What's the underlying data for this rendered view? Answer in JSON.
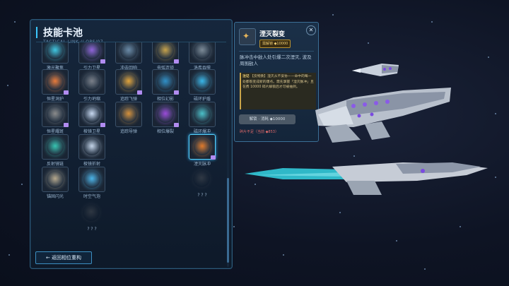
{
  "panel": {
    "title": "技能卡池",
    "subtitle": "TACTICAL LINK // OPS/07",
    "back_label": "← 返回相位重构"
  },
  "skills": [
    {
      "label": "激光聚焦",
      "color": "#3ec6e0",
      "badge": false,
      "selected": false,
      "locked": false
    },
    {
      "label": "引力卫星",
      "color": "#8f63d8",
      "badge": true,
      "selected": false,
      "locked": false
    },
    {
      "label": "冲击回响",
      "color": "#6a8aa6",
      "badge": false,
      "selected": false,
      "locked": false
    },
    {
      "label": "电弧连锁",
      "color": "#c7a24a",
      "badge": true,
      "selected": false,
      "locked": false
    },
    {
      "label": "洛希吞噬",
      "color": "#7c8a96",
      "badge": false,
      "selected": false,
      "locked": false
    },
    {
      "label": "恒星洞护",
      "color": "#e87a3a",
      "badge": true,
      "selected": false,
      "locked": false
    },
    {
      "label": "引力坍缩",
      "color": "#7a7f88",
      "badge": false,
      "selected": false,
      "locked": false
    },
    {
      "label": "追踪飞弹",
      "color": "#e1a33a",
      "badge": true,
      "selected": false,
      "locked": false
    },
    {
      "label": "相位幻影",
      "color": "#2f8fc6",
      "badge": true,
      "selected": false,
      "locked": false
    },
    {
      "label": "磁环护盾",
      "color": "#38b6e8",
      "badge": false,
      "selected": false,
      "locked": false
    },
    {
      "label": "恒星耀斑",
      "color": "#8a8a8a",
      "badge": true,
      "selected": false,
      "locked": false
    },
    {
      "label": "棱镜卫星",
      "color": "#c8d8f0",
      "badge": true,
      "selected": false,
      "locked": false
    },
    {
      "label": "追踪导弹",
      "color": "#d4903a",
      "badge": false,
      "selected": false,
      "locked": false
    },
    {
      "label": "相位爆裂",
      "color": "#9a4ad8",
      "badge": true,
      "selected": false,
      "locked": false
    },
    {
      "label": "磁环爆冲",
      "color": "#4ac0c8",
      "badge": false,
      "selected": false,
      "locked": false
    },
    {
      "label": "反射镜链",
      "color": "#36c4b0",
      "badge": false,
      "selected": false,
      "locked": false
    },
    {
      "label": "棱镜折射",
      "color": "#c4d4e8",
      "badge": false,
      "selected": false,
      "locked": false
    },
    {
      "label": "湮灭脉冲",
      "color": "#e07a2a",
      "badge": true,
      "selected": true,
      "locked": false
    },
    {
      "label": "锚固闪光",
      "color": "#b6a88c",
      "badge": false,
      "selected": false,
      "locked": false
    },
    {
      "label": "时空气泡",
      "color": "#4ab4e8",
      "badge": false,
      "selected": false,
      "locked": false
    },
    {
      "label": "? ? ?",
      "color": "#6a6a6a",
      "badge": false,
      "selected": false,
      "locked": true
    },
    {
      "label": "? ? ?",
      "color": "#6a6a6a",
      "badge": false,
      "selected": false,
      "locked": true
    }
  ],
  "detail": {
    "icon": "✦",
    "title": "湮灭裂变",
    "tag": "需解锁 ◆10000",
    "close": "✕",
    "description": "脉冲击中敌人处引爆二次湮灭, 波及周围敌人",
    "note_label": "注记",
    "note_text": "【反物质】湮灭从不妥协——命中的每一处都裂变成新的爆点。需先掌握「湮灭脉冲」且花费 10000 碎片解锁后才可被抽到。",
    "unlock_button": "解锁 · 消耗 ◆10000",
    "warning": "碎片不足（当前 ◆853）"
  },
  "colors": {
    "accent": "#3cc8ff",
    "badge": "#b18cf0",
    "warning": "#e26a6a",
    "gold": "#f2cf73"
  }
}
